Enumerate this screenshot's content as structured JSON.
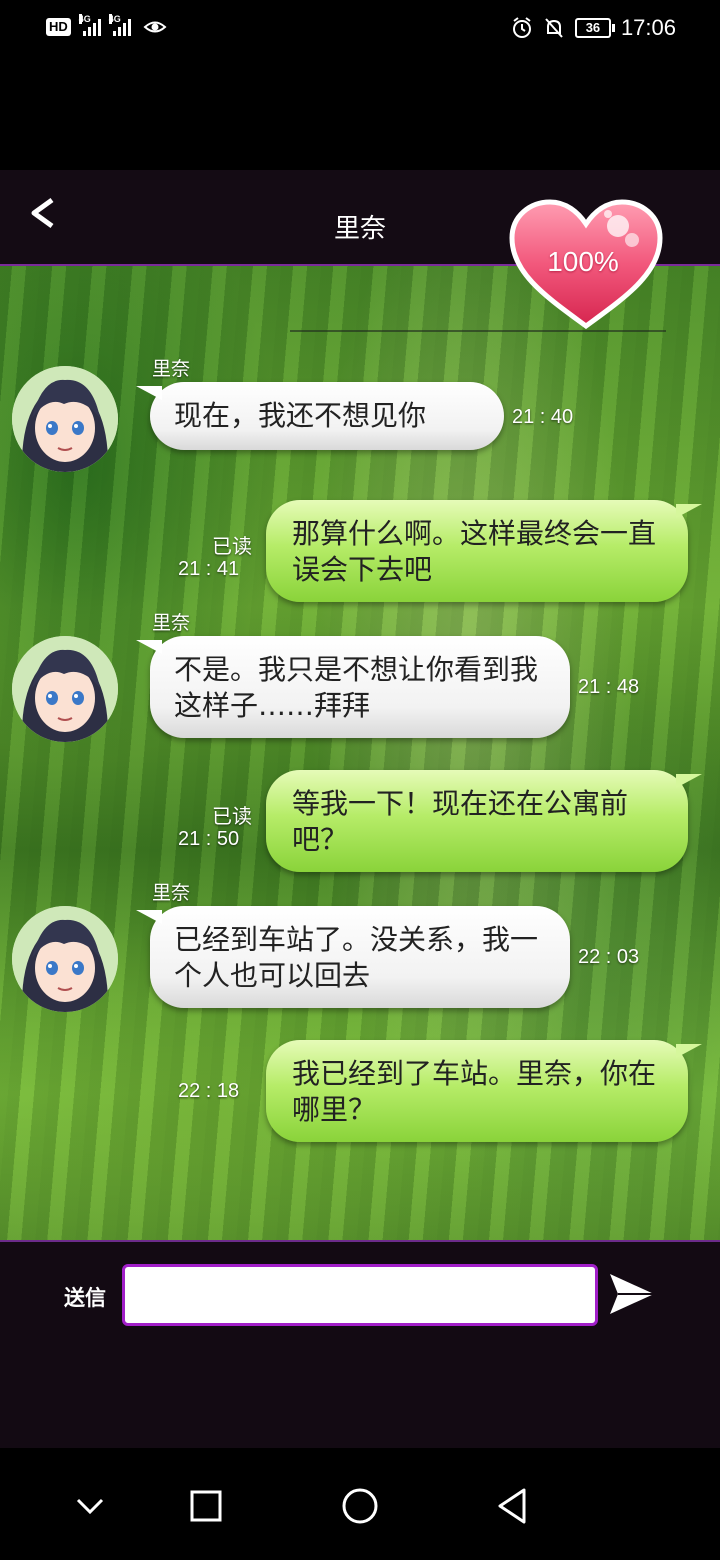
{
  "status_bar": {
    "left_badge": "HD",
    "network1": "4G",
    "network2": "4G",
    "battery": "36",
    "time": "17:06"
  },
  "header": {
    "back_label": "<",
    "title": "里奈"
  },
  "affection": {
    "percent_label": "100%",
    "value": 1.0
  },
  "messages": [
    {
      "from": "里奈",
      "direction": "incoming",
      "text": "现在，我还不想见你",
      "time": "21 : 40"
    },
    {
      "direction": "outgoing",
      "read": "已读",
      "text": "那算什么啊。这样最终会一直误会下去吧",
      "time": "21 : 41"
    },
    {
      "from": "里奈",
      "direction": "incoming",
      "text": "不是。我只是不想让你看到我这样子……拜拜",
      "time": "21 : 48"
    },
    {
      "direction": "outgoing",
      "read": "已读",
      "text": "等我一下！现在还在公寓前吧？",
      "time": "21 : 50"
    },
    {
      "from": "里奈",
      "direction": "incoming",
      "text": "已经到车站了。没关系，我一个人也可以回去",
      "time": "22 : 03"
    },
    {
      "direction": "outgoing",
      "text": "我已经到了车站。里奈，你在哪里？",
      "time": "22 : 18"
    }
  ],
  "input": {
    "send_label": "送信",
    "value": "",
    "placeholder": ""
  },
  "colors": {
    "header_bg": "#140b14",
    "accent_purple": "#a21fc9",
    "bubble_out": "#b6ec68",
    "bubble_in": "#ffffff",
    "heart": "#f0567a"
  },
  "icons": [
    "hd-icon",
    "signal-icon",
    "eye-icon",
    "alarm-icon",
    "mute-icon",
    "battery-icon",
    "back-icon",
    "heart-icon",
    "send-icon",
    "nav-back-icon",
    "nav-home-icon",
    "nav-recents-icon",
    "nav-down-icon"
  ]
}
